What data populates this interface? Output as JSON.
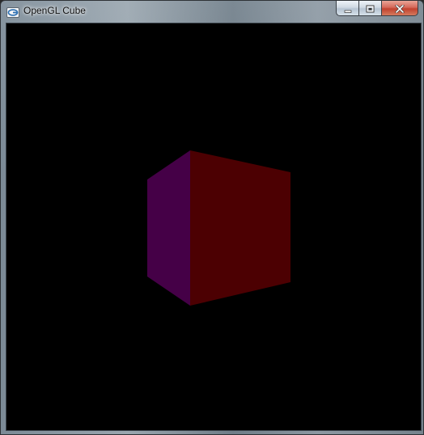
{
  "window": {
    "title": "OpenGL Cube",
    "app_icon": "opengl-app-icon",
    "caption_buttons": {
      "minimize_icon": "minimize-icon",
      "maximize_icon": "maximize-icon",
      "close_icon": "close-icon"
    }
  },
  "viewport": {
    "background_color": "#000000",
    "cube": {
      "front_face_color": "#4c0002",
      "side_face_color": "#450047"
    }
  }
}
